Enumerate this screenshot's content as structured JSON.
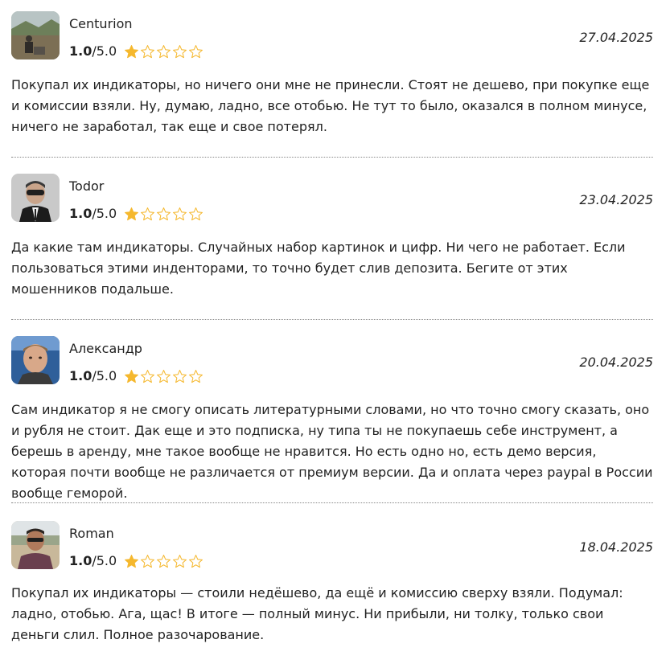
{
  "reviews": [
    {
      "author": "Centurion",
      "score": "1.0",
      "max_score": "/5.0",
      "rating": 1,
      "date": "27.04.2025",
      "text": "Покупал их индикаторы, но ничего они мне не принесли. Стоят не дешево, при покупке еще и комиссии взяли. Ну, думаю, ладно, все отобью. Не тут то было, оказался в полном минусе, ничего не заработал, так еще и свое потерял."
    },
    {
      "author": "Todor",
      "score": "1.0",
      "max_score": "/5.0",
      "rating": 1,
      "date": "23.04.2025",
      "text": "Да какие там индикаторы. Случайных набор картинок и цифр. Ни чего не работает. Если пользоваться этими инденторами, то точно будет слив депозита. Бегите от этих мошенников подальше."
    },
    {
      "author": "Александр",
      "score": "1.0",
      "max_score": "/5.0",
      "rating": 1,
      "date": "20.04.2025",
      "text": "Сам индикатор я не смогу описать литературными словами, но что точно смогу сказать, оно и рубля не стоит. Дак еще и это подписка, ну типа ты не покупаешь себе инструмент, а берешь в аренду, мне такое вообще не нравится. Но есть одно но, есть демо версия, которая почти вообще не различается от премиум версии. Да и оплата через paypal в России вообще геморой."
    },
    {
      "author": "Roman",
      "score": "1.0",
      "max_score": "/5.0",
      "rating": 1,
      "date": "18.04.2025",
      "text": "Покупал их индикаторы — стоили недёшево, да ещё и комиссию сверху взяли. Подумал: ладно, отобью. Ага, щас! В итоге — полный минус. Ни прибыли, ни толку, только свои деньги слил. Полное разочарование."
    }
  ],
  "colors": {
    "star_fill": "#f5b82e",
    "star_outline": "#f5b82e",
    "text": "#222222",
    "divider": "#888888"
  },
  "icons": {
    "star_full": "star-full-icon",
    "star_half": "star-half-icon",
    "star_empty": "star-empty-icon"
  }
}
